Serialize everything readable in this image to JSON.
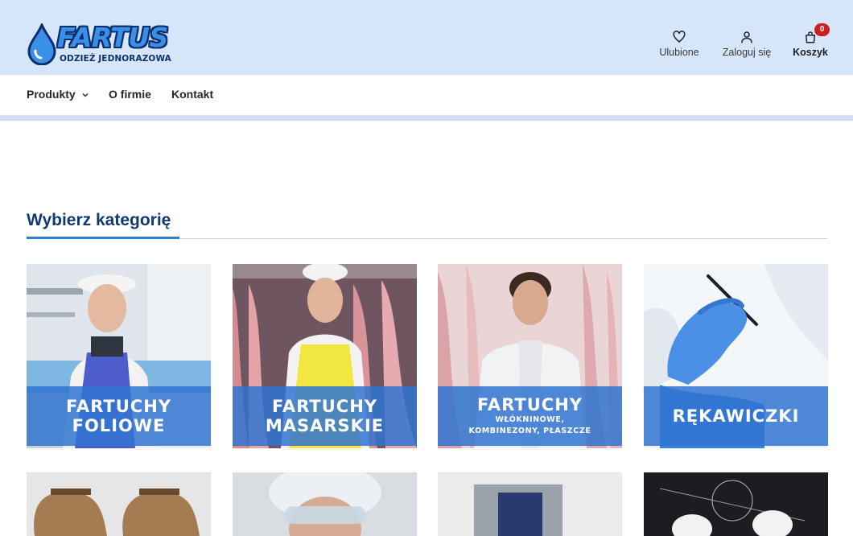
{
  "brand": {
    "name": "FARTUS",
    "tagline": "ODZIEŻ JEDNORAZOWA",
    "primary_color": "#113a73",
    "accent_color": "#3a8fe6",
    "header_bg": "#d6e6fa"
  },
  "header": {
    "favorites": {
      "label": "Ulubione",
      "icon": "heart-icon"
    },
    "login": {
      "label": "Zaloguj się",
      "icon": "user-icon"
    },
    "cart": {
      "label": "Koszyk",
      "icon": "bag-icon",
      "count": "0"
    }
  },
  "nav": {
    "items": [
      {
        "label": "Produkty",
        "has_dropdown": true
      },
      {
        "label": "O firmie"
      },
      {
        "label": "Kontakt"
      }
    ]
  },
  "main": {
    "section_title": "Wybierz kategorię",
    "categories": [
      {
        "title_line1": "FARTUCHY",
        "title_line2": "FOLIOWE"
      },
      {
        "title_line1": "FARTUCHY",
        "title_line2": "MASARSKIE"
      },
      {
        "title_line1": "FARTUCHY",
        "subtitle_line1": "WŁÓKNINOWE,",
        "subtitle_line2": "KOMBINEZONY, PŁASZCZE"
      },
      {
        "title_line1": "RĘKAWICZKI"
      }
    ]
  }
}
